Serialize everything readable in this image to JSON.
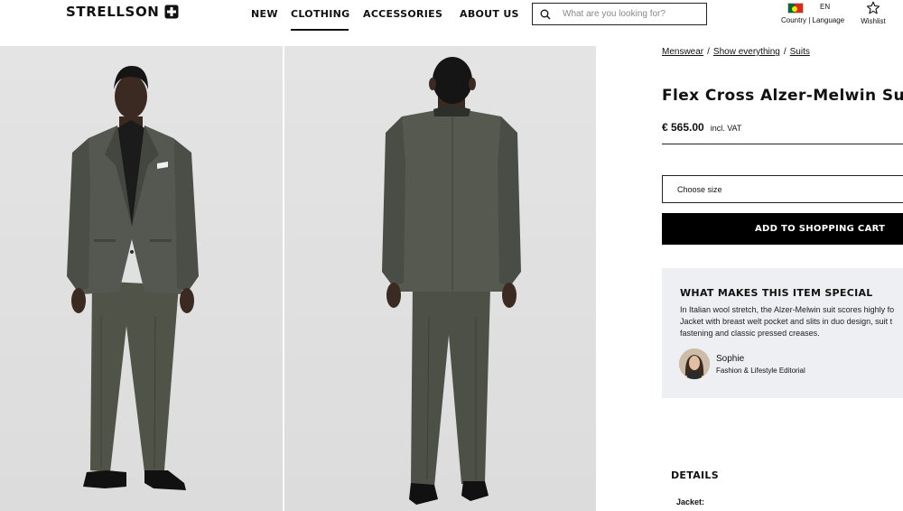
{
  "brand": {
    "logo_text": "STRELLSON"
  },
  "nav": {
    "items": [
      {
        "label": "NEW"
      },
      {
        "label": "CLOTHING",
        "active": true
      },
      {
        "label": "ACCESSORIES"
      },
      {
        "label": "ABOUT US"
      }
    ]
  },
  "search": {
    "placeholder": "What are you looking for?"
  },
  "country": {
    "language_code": "EN",
    "label": "Country | Language",
    "flag": "portugal-flag"
  },
  "wishlist": {
    "label": "Wishlist"
  },
  "gallery": {
    "images": [
      {
        "name": "model-front-view"
      },
      {
        "name": "model-back-view"
      }
    ]
  },
  "breadcrumb": {
    "items": [
      "Menswear",
      "Show everything",
      "Suits"
    ]
  },
  "product": {
    "title": "Flex Cross Alzer-Melwin Suit",
    "price": "€ 565.00",
    "vat_note": "incl. VAT"
  },
  "size_select": {
    "placeholder": "Choose size"
  },
  "cart_button": {
    "label": "ADD TO SHOPPING CART"
  },
  "special": {
    "heading": "WHAT MAKES THIS ITEM SPECIAL",
    "lines": [
      "In Italian wool stretch, the Alzer-Melwin suit scores highly fo",
      "Jacket with breast welt pocket and slits in duo design, suit t",
      "fastening and classic pressed creases."
    ],
    "author_name": "Sophie",
    "author_role": "Fashion & Lifestyle Editorial"
  },
  "details": {
    "heading": "DETAILS",
    "jacket_label": "Jacket:"
  },
  "colors": {
    "suit": "#4e5249",
    "cart_button_bg": "#000000",
    "special_bg": "#eeeff2",
    "photo_bg": "#e2e2e2"
  }
}
